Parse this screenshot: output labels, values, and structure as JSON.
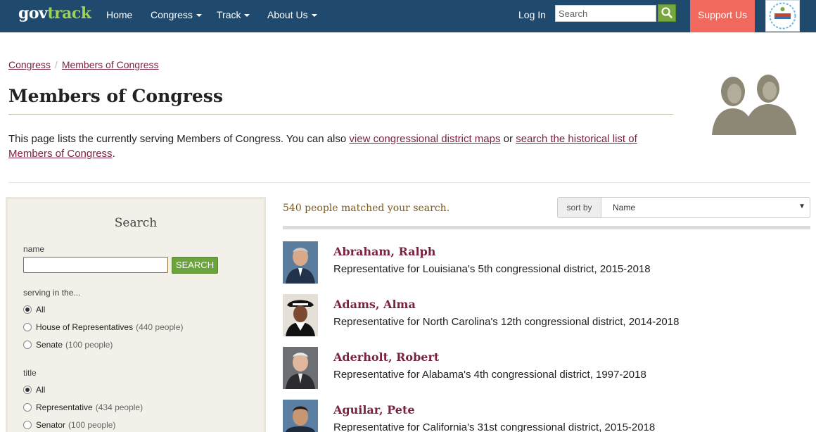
{
  "nav": {
    "logo_gov": "gov",
    "logo_track": "track",
    "items": [
      {
        "label": "Home",
        "dropdown": false
      },
      {
        "label": "Congress",
        "dropdown": true
      },
      {
        "label": "Track",
        "dropdown": true
      },
      {
        "label": "About Us",
        "dropdown": true
      }
    ],
    "login": "Log In",
    "search_placeholder": "Search",
    "support": "Support Us"
  },
  "breadcrumb": [
    "Congress",
    "Members of Congress"
  ],
  "page_title": "Members of Congress",
  "intro": {
    "text1": "This page lists the currently serving Members of Congress. You can also ",
    "link1": "view congressional district maps",
    "text2": " or ",
    "link2": "search the historical list of Members of Congress",
    "text3": "."
  },
  "sidebar": {
    "title": "Search",
    "name_label": "name",
    "search_button": "SEARCH",
    "serving_label": "serving in the...",
    "serving_options": [
      {
        "label": "All",
        "count": "",
        "checked": true
      },
      {
        "label": "House of Representatives",
        "count": "(440 people)",
        "checked": false
      },
      {
        "label": "Senate",
        "count": "(100 people)",
        "checked": false
      }
    ],
    "title_label": "title",
    "title_options": [
      {
        "label": "All",
        "count": "",
        "checked": true
      },
      {
        "label": "Representative",
        "count": "(434 people)",
        "checked": false
      },
      {
        "label": "Senator",
        "count": "(100 people)",
        "checked": false
      }
    ]
  },
  "results": {
    "count_text": "540 people matched your search.",
    "sort_label": "sort by",
    "sort_value": "Name",
    "members": [
      {
        "name": "Abraham, Ralph",
        "desc": "Representative for Louisiana's 5th congressional district, 2015-2018"
      },
      {
        "name": "Adams, Alma",
        "desc": "Representative for North Carolina's 12th congressional district, 2014-2018"
      },
      {
        "name": "Aderholt, Robert",
        "desc": "Representative for Alabama's 4th congressional district, 1997-2018"
      },
      {
        "name": "Aguilar, Pete",
        "desc": "Representative for California's 31st congressional district, 2015-2018"
      }
    ]
  },
  "colors": {
    "navbar": "#1f4a6e",
    "accent_green": "#76a83e",
    "support": "#f1695c",
    "link": "#7a2242"
  }
}
